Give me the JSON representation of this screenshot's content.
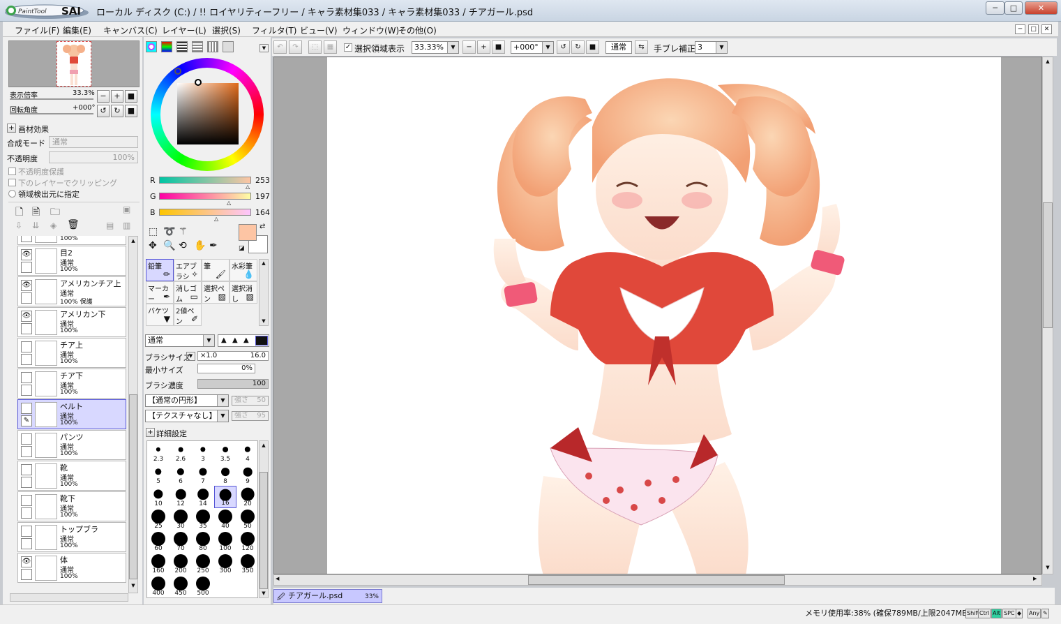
{
  "window": {
    "title": "ローカル ディスク (C:) / !! ロイヤリティーフリー / キャラ素材集033 / キャラ素材集033 / チアガール.psd",
    "logo_text": "PaintTool SAI"
  },
  "menu": [
    "ファイル(F)",
    "編集(E)",
    "キャンバス(C)",
    "レイヤー(L)",
    "選択(S)",
    "フィルタ(T)",
    "ビュー(V)",
    "ウィンドウ(W)",
    "その他(O)"
  ],
  "navigator": {
    "zoom_label": "表示倍率",
    "zoom_value": "33.3%",
    "rotate_label": "回転角度",
    "rotate_value": "+000°"
  },
  "layer_props": {
    "texture_label": "画材効果",
    "blend_label": "合成モード",
    "blend_value": "通常",
    "opacity_label": "不透明度",
    "opacity_value": "100%",
    "preserve_opacity": "不透明度保護",
    "clip_lower": "下のレイヤーでクリッピング",
    "selection_source": "領域検出元に指定"
  },
  "layers": [
    {
      "name": "",
      "mode": "通常",
      "opacity": "100%",
      "visible": false,
      "extra": ""
    },
    {
      "name": "目2",
      "mode": "通常",
      "opacity": "100%",
      "visible": true,
      "extra": ""
    },
    {
      "name": "アメリカンチア上",
      "mode": "通常",
      "opacity": "100%",
      "visible": true,
      "extra": "保護"
    },
    {
      "name": "アメリカン下",
      "mode": "通常",
      "opacity": "100%",
      "visible": true,
      "extra": ""
    },
    {
      "name": "チア上",
      "mode": "通常",
      "opacity": "100%",
      "visible": false,
      "extra": ""
    },
    {
      "name": "チア下",
      "mode": "通常",
      "opacity": "100%",
      "visible": false,
      "extra": ""
    },
    {
      "name": "ベルト",
      "mode": "通常",
      "opacity": "100%",
      "visible": false,
      "extra": "",
      "selected": true
    },
    {
      "name": "パンツ",
      "mode": "通常",
      "opacity": "100%",
      "visible": false,
      "extra": ""
    },
    {
      "name": "靴",
      "mode": "通常",
      "opacity": "100%",
      "visible": false,
      "extra": ""
    },
    {
      "name": "靴下",
      "mode": "通常",
      "opacity": "100%",
      "visible": false,
      "extra": ""
    },
    {
      "name": "トップブラ",
      "mode": "通常",
      "opacity": "100%",
      "visible": false,
      "extra": ""
    },
    {
      "name": "体",
      "mode": "通常",
      "opacity": "100%",
      "visible": true,
      "extra": ""
    }
  ],
  "color": {
    "r_label": "R",
    "g_label": "G",
    "b_label": "B",
    "r": 253,
    "g": 197,
    "b": 164,
    "r_value": "253",
    "g_value": "197",
    "b_value": "164",
    "primary": "#fdc5a4",
    "secondary": "#ffffff"
  },
  "tools": [
    {
      "label": "鉛筆",
      "selected": true
    },
    {
      "label": "エアブラシ"
    },
    {
      "label": "筆"
    },
    {
      "label": "水彩筆"
    },
    {
      "label": "マーカー"
    },
    {
      "label": "消しゴム"
    },
    {
      "label": "選択ペン"
    },
    {
      "label": "選択消し"
    },
    {
      "label": "バケツ"
    },
    {
      "label": "2値ペン"
    }
  ],
  "brush": {
    "mode": "通常",
    "size_label": "ブラシサイズ",
    "size_mult": "×1.0",
    "size_value": "16.0",
    "min_label": "最小サイズ",
    "min_value": "0%",
    "density_label": "ブラシ濃度",
    "density_value": "100",
    "shape": "【通常の円形】",
    "shape_strength_label": "強さ",
    "shape_strength": "50",
    "texture": "【テクスチャなし】",
    "texture_strength_label": "強さ",
    "texture_strength": "95",
    "advanced_label": "詳細設定"
  },
  "brush_sizes": [
    "2.3",
    "2.6",
    "3",
    "3.5",
    "4",
    "5",
    "6",
    "7",
    "8",
    "9",
    "10",
    "12",
    "14",
    "16",
    "20",
    "25",
    "30",
    "35",
    "40",
    "50",
    "60",
    "70",
    "80",
    "100",
    "120",
    "160",
    "200",
    "250",
    "300",
    "350",
    "400",
    "450",
    "500"
  ],
  "toolbar": {
    "show_selection": "選択領域表示",
    "zoom": "33.33%",
    "rotation": "+000°",
    "blend": "通常",
    "stabilizer_label": "手ブレ補正",
    "stabilizer_value": "3"
  },
  "document_tab": {
    "name": "チアガール.psd",
    "zoom": "33%"
  },
  "status": {
    "memory": "メモリ使用率:38% (確保789MB/上限2047MB)",
    "keys": [
      "Shift",
      "Ctrl",
      "Alt",
      "SPC",
      "◆",
      "Any",
      "✎"
    ]
  }
}
